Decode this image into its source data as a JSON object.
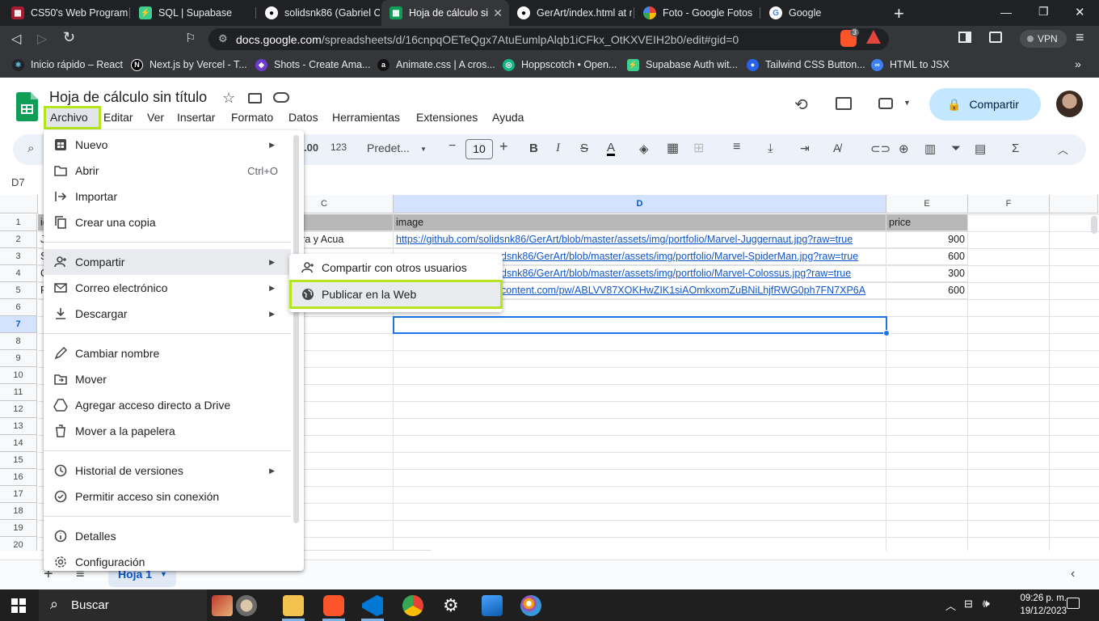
{
  "browser": {
    "tabs": [
      {
        "label": "CS50's Web Programm",
        "icon": "harvard-icon"
      },
      {
        "label": "SQL | Supabase",
        "icon": "supabase-icon"
      },
      {
        "label": "solidsnk86 (Gabriel Ca",
        "icon": "github-icon"
      },
      {
        "label": "Hoja de cálculo si",
        "icon": "sheets-icon",
        "active": true
      },
      {
        "label": "GerArt/index.html at m",
        "icon": "github-icon"
      },
      {
        "label": "Foto - Google Fotos",
        "icon": "photos-icon"
      },
      {
        "label": "Google",
        "icon": "google-icon"
      }
    ],
    "url_host": "docs.google.com",
    "url_path": "/spreadsheets/d/16cnpqOETeQgx7AtuEumlpAlqb1iCFkx_OtKXVEIH2b0/edit#gid=0",
    "vpn_label": "VPN",
    "brave_badge": "3",
    "bookmarks": [
      {
        "label": "Inicio rápido – React",
        "color": "#20232a",
        "glyph": "⚛"
      },
      {
        "label": "Next.js by Vercel - T...",
        "color": "#000000",
        "glyph": "N"
      },
      {
        "label": "Shots - Create Ama...",
        "color": "#6e3bd1",
        "glyph": "◆"
      },
      {
        "label": "Animate.css | A cros...",
        "color": "#111111",
        "glyph": "a"
      },
      {
        "label": "Hoppscotch • Open...",
        "color": "#10b981",
        "glyph": "◎"
      },
      {
        "label": "Supabase Auth wit...",
        "color": "#3ecf8e",
        "glyph": "⚡"
      },
      {
        "label": "Tailwind CSS Button...",
        "color": "#2563eb",
        "glyph": "●"
      },
      {
        "label": "HTML to JSX",
        "color": "#3b82f6",
        "glyph": "∞"
      }
    ]
  },
  "sheets": {
    "title": "Hoja de cálculo sin título",
    "menus": [
      "Archivo",
      "Editar",
      "Ver",
      "Insertar",
      "Formato",
      "Datos",
      "Herramientas",
      "Extensiones",
      "Ayuda"
    ],
    "share_label": "Compartir",
    "toolbar": {
      "number_format": "123",
      "decimals": ".00",
      "font": "Predet...",
      "font_size": "10"
    },
    "cell_ref": "D7",
    "columns": [
      "C",
      "D",
      "E",
      "F"
    ],
    "rows": [
      "1",
      "2",
      "3",
      "4",
      "5",
      "6",
      "7",
      "8",
      "9",
      "10",
      "11",
      "12",
      "13",
      "14",
      "15",
      "16",
      "17",
      "18",
      "19",
      "20"
    ],
    "cells": {
      "r1": {
        "c": "n",
        "d": "image",
        "e": "price",
        "a": "ic"
      },
      "r2": {
        "a": "J",
        "c": "n microfibra y Acua",
        "d": "https://github.com/solidsnk86/GerArt/blob/master/assets/img/portfolio/Marvel-Juggernaut.jpg?raw=true",
        "e": "900"
      },
      "r3": {
        "a": "S",
        "d": "dsnk86/GerArt/blob/master/assets/img/portfolio/Marvel-SpiderMan.jpg?raw=true",
        "e": "600"
      },
      "r4": {
        "a": "C",
        "d": "dsnk86/GerArt/blob/master/assets/img/portfolio/Marvel-Colossus.jpg?raw=true",
        "e": "300"
      },
      "r5": {
        "a": "P",
        "d": "content.com/pw/ABLVV87XOKHwZIK1siAOmkxomZuBNiLhjfRWG0ph7FN7XP6A",
        "e": "600"
      }
    },
    "sheet_tab": "Hoja 1"
  },
  "archivo_menu": {
    "items": [
      {
        "label": "Nuevo",
        "icon": "new-sheet-icon",
        "submenu": true
      },
      {
        "label": "Abrir",
        "icon": "folder-icon",
        "shortcut": "Ctrl+O"
      },
      {
        "label": "Importar",
        "icon": "import-icon"
      },
      {
        "label": "Crear una copia",
        "icon": "copy-icon"
      },
      {
        "label": "Compartir",
        "icon": "person-add-icon",
        "submenu": true
      },
      {
        "label": "Correo electrónico",
        "icon": "mail-icon",
        "submenu": true
      },
      {
        "label": "Descargar",
        "icon": "download-icon",
        "submenu": true
      },
      {
        "label": "Cambiar nombre",
        "icon": "rename-icon"
      },
      {
        "label": "Mover",
        "icon": "move-folder-icon"
      },
      {
        "label": "Agregar acceso directo a Drive",
        "icon": "drive-shortcut-icon"
      },
      {
        "label": "Mover a la papelera",
        "icon": "trash-icon"
      },
      {
        "label": "Historial de versiones",
        "icon": "history-icon",
        "submenu": true
      },
      {
        "label": "Permitir acceso sin conexión",
        "icon": "offline-icon"
      },
      {
        "label": "Detalles",
        "icon": "info-icon"
      },
      {
        "label": "Configuración",
        "icon": "settings-icon"
      }
    ],
    "share_submenu": [
      {
        "label": "Compartir con otros usuarios",
        "icon": "person-add-icon"
      },
      {
        "label": "Publicar en la Web",
        "icon": "globe-icon"
      }
    ]
  },
  "taskbar": {
    "search_label": "Buscar",
    "time": "09:26 p. m.",
    "date": "19/12/2023"
  },
  "colors": {
    "highlight": "#b5e61d",
    "accent": "#1a73e8",
    "share_bg": "#c2e7ff"
  }
}
